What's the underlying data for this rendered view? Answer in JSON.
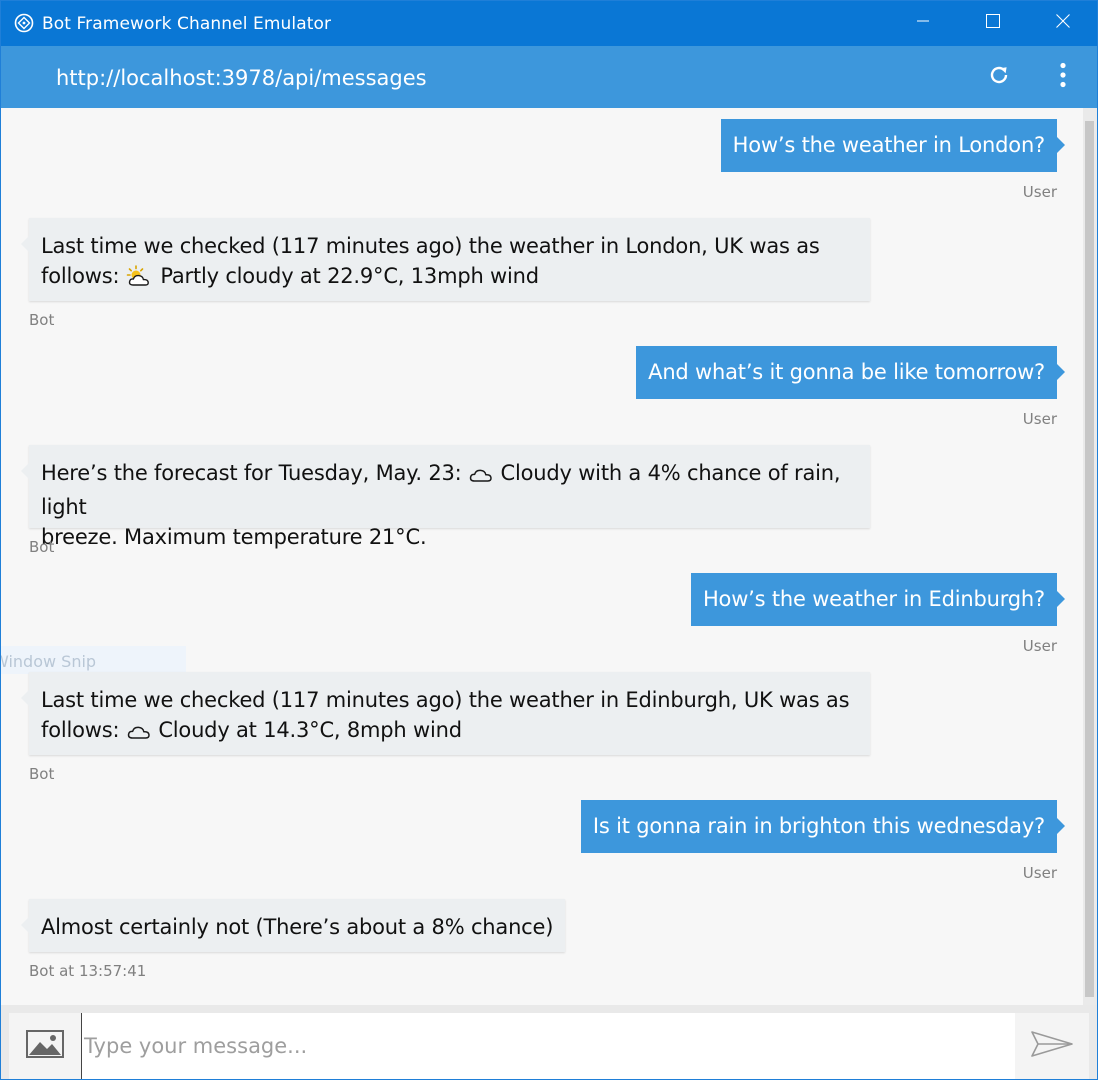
{
  "window": {
    "title": "Bot Framework Channel Emulator",
    "address": "http://localhost:3978/api/messages",
    "icons": {
      "app": "bot-framework-logo-icon",
      "minimize": "minimize-icon",
      "maximize": "maximize-icon",
      "close": "close-icon",
      "refresh": "refresh-icon",
      "menu": "more-vertical-icon"
    }
  },
  "colors": {
    "titlebar": "#0a77d5",
    "addressbar": "#3d97dc",
    "user_bubble": "#3d97dc",
    "bot_bubble": "#eceff1"
  },
  "chat": {
    "messages": [
      {
        "from": "user",
        "text": "How’s the weather in London?",
        "sender": "User"
      },
      {
        "from": "bot",
        "line1": "Last time we checked (117 minutes ago) the weather in London, UK was as",
        "line2_prefix": "follows:",
        "icon": "partly-cloudy-icon",
        "line2_suffix": "Partly cloudy at 22.9°C, 13mph wind",
        "sender": "Bot"
      },
      {
        "from": "user",
        "text": "And what’s it gonna be like tomorrow?",
        "sender": "User"
      },
      {
        "from": "bot",
        "line1_prefix": "Here’s the forecast for Tuesday, May. 23:",
        "icon": "cloud-icon",
        "line1_suffix": "Cloudy with a 4% chance of rain, light",
        "line2": "breeze. Maximum temperature 21°C.",
        "sender": "Bot"
      },
      {
        "from": "user",
        "text": "How’s the weather in Edinburgh?",
        "sender": "User"
      },
      {
        "from": "bot",
        "line1": "Last time we checked (117 minutes ago) the weather in Edinburgh, UK was as",
        "line2_prefix": "follows:",
        "icon": "cloud-icon",
        "line2_suffix": "Cloudy at 14.3°C, 8mph wind",
        "sender": "Bot"
      },
      {
        "from": "user",
        "text": "Is it gonna rain in brighton this wednesday?",
        "sender": "User"
      },
      {
        "from": "bot",
        "text": "Almost certainly not (There’s about a 8% chance)",
        "sender": "Bot at 13:57:41"
      }
    ],
    "overlay_label": "Window Snip"
  },
  "input": {
    "placeholder": "Type your message...",
    "value": "",
    "attach_icon": "image-icon",
    "send_icon": "send-icon"
  }
}
